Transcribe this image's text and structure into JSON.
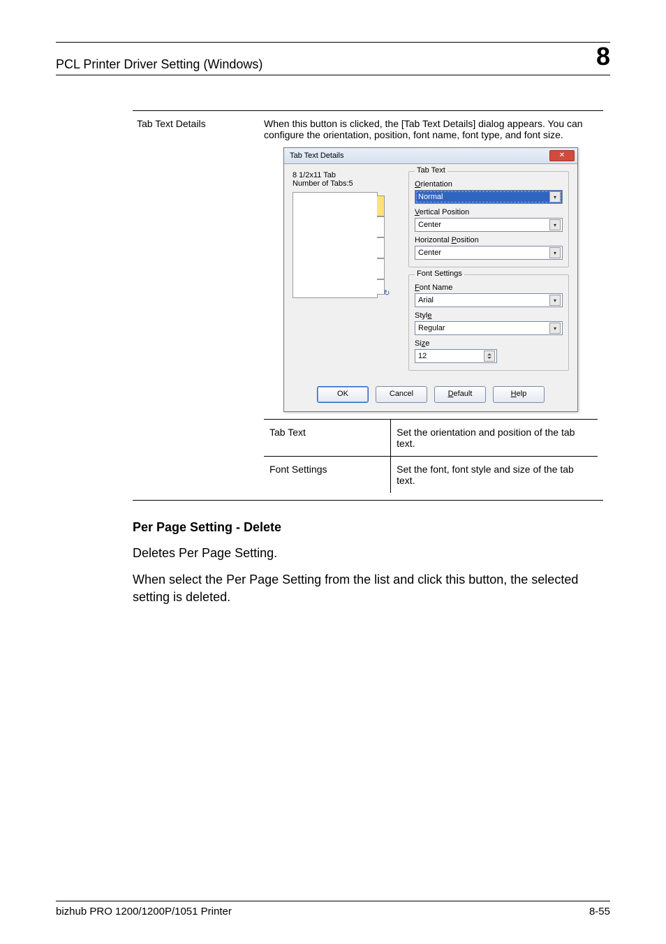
{
  "header": {
    "title": "PCL Printer Driver Setting (Windows)",
    "chapter": "8"
  },
  "details_table": {
    "row_label": "Tab Text Details",
    "row_desc": "When this button is clicked, the [Tab Text Details] dialog appears. You can configure the orientation, position, font name, font type, and font size.",
    "inner": [
      {
        "label": "Tab Text",
        "desc": "Set the orientation and position of the tab text."
      },
      {
        "label": "Font Settings",
        "desc": "Set the font, font style and size of the tab text."
      }
    ]
  },
  "dialog": {
    "title": "Tab Text Details",
    "left": {
      "size_label": "8 1/2x11 Tab",
      "count_label": "Number of Tabs:5"
    },
    "tab_text_group": {
      "legend": "Tab Text",
      "orientation_label": "Orientation",
      "orientation_value": "Normal",
      "vpos_label": "Vertical Position",
      "vpos_value": "Center",
      "hpos_label": "Horizontal Position",
      "hpos_value": "Center"
    },
    "font_group": {
      "legend": "Font Settings",
      "name_label": "Font Name",
      "name_value": "Arial",
      "style_label": "Style",
      "style_value": "Regular",
      "size_label": "Size",
      "size_value": "12"
    },
    "buttons": {
      "ok": "OK",
      "cancel": "Cancel",
      "default": "Default",
      "help": "Help"
    },
    "close_glyph": "✕"
  },
  "section": {
    "heading": "Per Page Setting - Delete",
    "p1": "Deletes Per Page Setting.",
    "p2": "When select the Per Page Setting from the list and click this button, the selected setting is deleted."
  },
  "footer": {
    "product": "bizhub PRO 1200/1200P/1051 Printer",
    "page": "8-55"
  },
  "keys": {
    "orientation_u": "O",
    "vpos_u": "V",
    "hpos_u": "P",
    "fontname_u": "F",
    "style_u": "e",
    "size_u": "z",
    "default_u": "D",
    "help_u": "H"
  }
}
